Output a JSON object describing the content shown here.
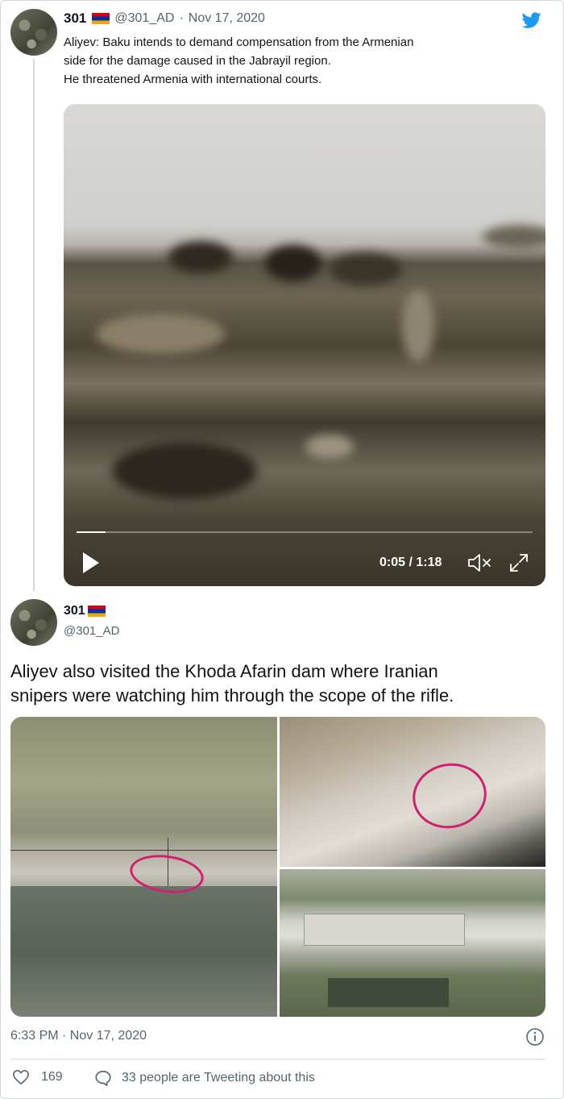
{
  "quoted_tweet": {
    "name": "301",
    "handle": "@301_AD",
    "separator": "·",
    "date": "Nov 17, 2020",
    "text_lines": [
      "Aliyev: Baku intends to demand compensation from the Armenian",
      "side for the damage caused in the Jabrayil region.",
      "He threatened Armenia with international courts."
    ],
    "video": {
      "time_display": "0:05 / 1:18",
      "progress_fraction": 0.064
    }
  },
  "main_tweet": {
    "name": "301",
    "handle": "@301_AD",
    "text_lines": [
      "Aliyev also visited the Khoda Afarin dam where Iranian",
      "snipers were watching him through the scope of the rifle."
    ],
    "timestamp": "6:33 PM · Nov 17, 2020",
    "likes": "169",
    "tweeting_about": "33 people are Tweeting about this"
  },
  "colors": {
    "twitter_blue": "#1d9bf0",
    "flag_red": "#d90012",
    "flag_blue": "#0033a0",
    "flag_orange": "#f2a800",
    "annotation_pink": "#d0206e"
  },
  "icons": [
    "twitter-bird-icon",
    "play-icon",
    "mute-icon",
    "expand-icon",
    "info-icon",
    "heart-icon",
    "chat-bubble-icon",
    "armenia-flag-icon"
  ]
}
